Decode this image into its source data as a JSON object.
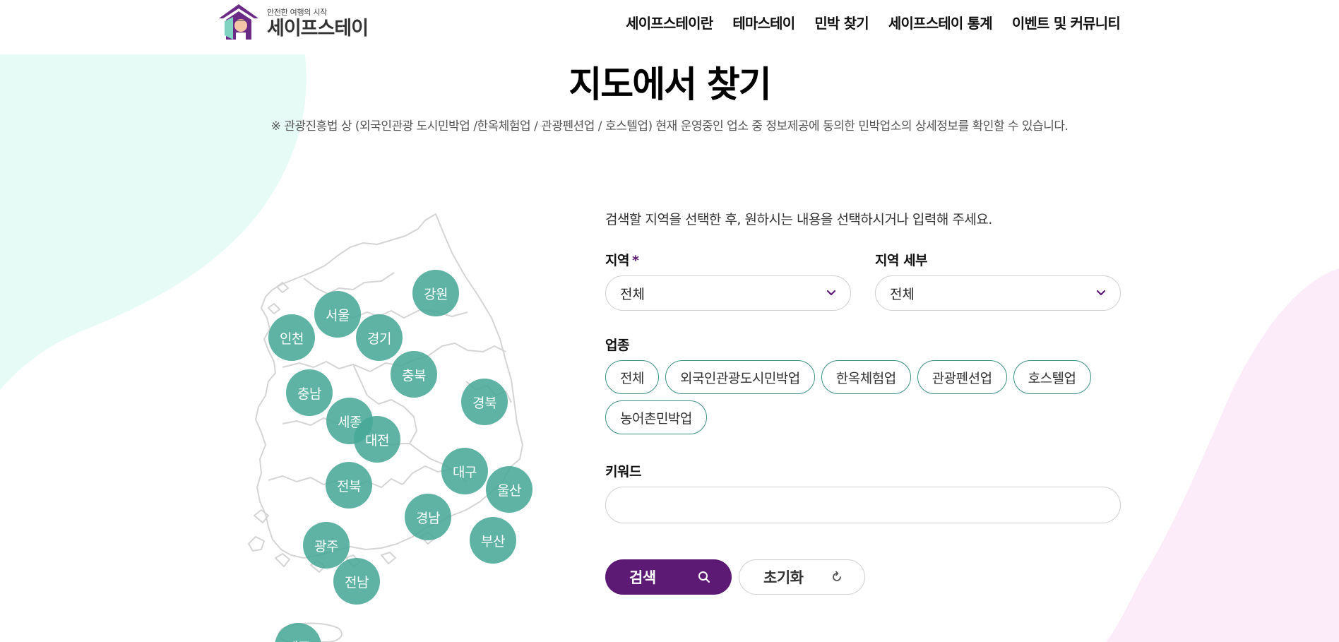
{
  "header": {
    "logo_tagline": "안전한 여행의 시작",
    "logo_name": "세이프스테이",
    "nav": [
      "세이프스테이란",
      "테마스테이",
      "민박 찾기",
      "세이프스테이 통계",
      "이벤트 및 커뮤니티"
    ]
  },
  "page": {
    "title": "지도에서 찾기",
    "notice": "※ 관광진흥법 상 (외국인관광 도시민박업 /한옥체험업 / 관광펜션업 / 호스텔업) 현재 운영중인 업소 중 정보제공에 동의한 민박업소의 상세정보를 확인할 수 있습니다."
  },
  "map": {
    "regions": [
      "강원",
      "서울",
      "인천",
      "경기",
      "충북",
      "충남",
      "경북",
      "세종",
      "대전",
      "대구",
      "울산",
      "전북",
      "경남",
      "부산",
      "광주",
      "전남",
      "제주"
    ]
  },
  "form": {
    "intro": "검색할 지역을 선택한 후, 원하시는 내용을 선택하시거나 입력해 주세요.",
    "region_label": "지역",
    "region_required": "*",
    "region_value": "전체",
    "subregion_label": "지역 세부",
    "subregion_value": "전체",
    "biz_label": "업종",
    "biz_types": [
      "전체",
      "외국인관광도시민박업",
      "한옥체험업",
      "관광펜션업",
      "호스텔업",
      "농어촌민박업"
    ],
    "keyword_label": "키워드",
    "keyword_value": "",
    "search_label": "검색",
    "reset_label": "초기화"
  },
  "icons": {
    "search": "search-icon",
    "reset": "refresh-icon",
    "dropdown": "chevron-down-icon"
  },
  "colors": {
    "brand_purple": "#5c1a75",
    "region_teal": "#48a898",
    "chip_border": "#3d8f83",
    "mint_bg": "#e6fbf6",
    "pink_bg": "#fcebf8"
  }
}
